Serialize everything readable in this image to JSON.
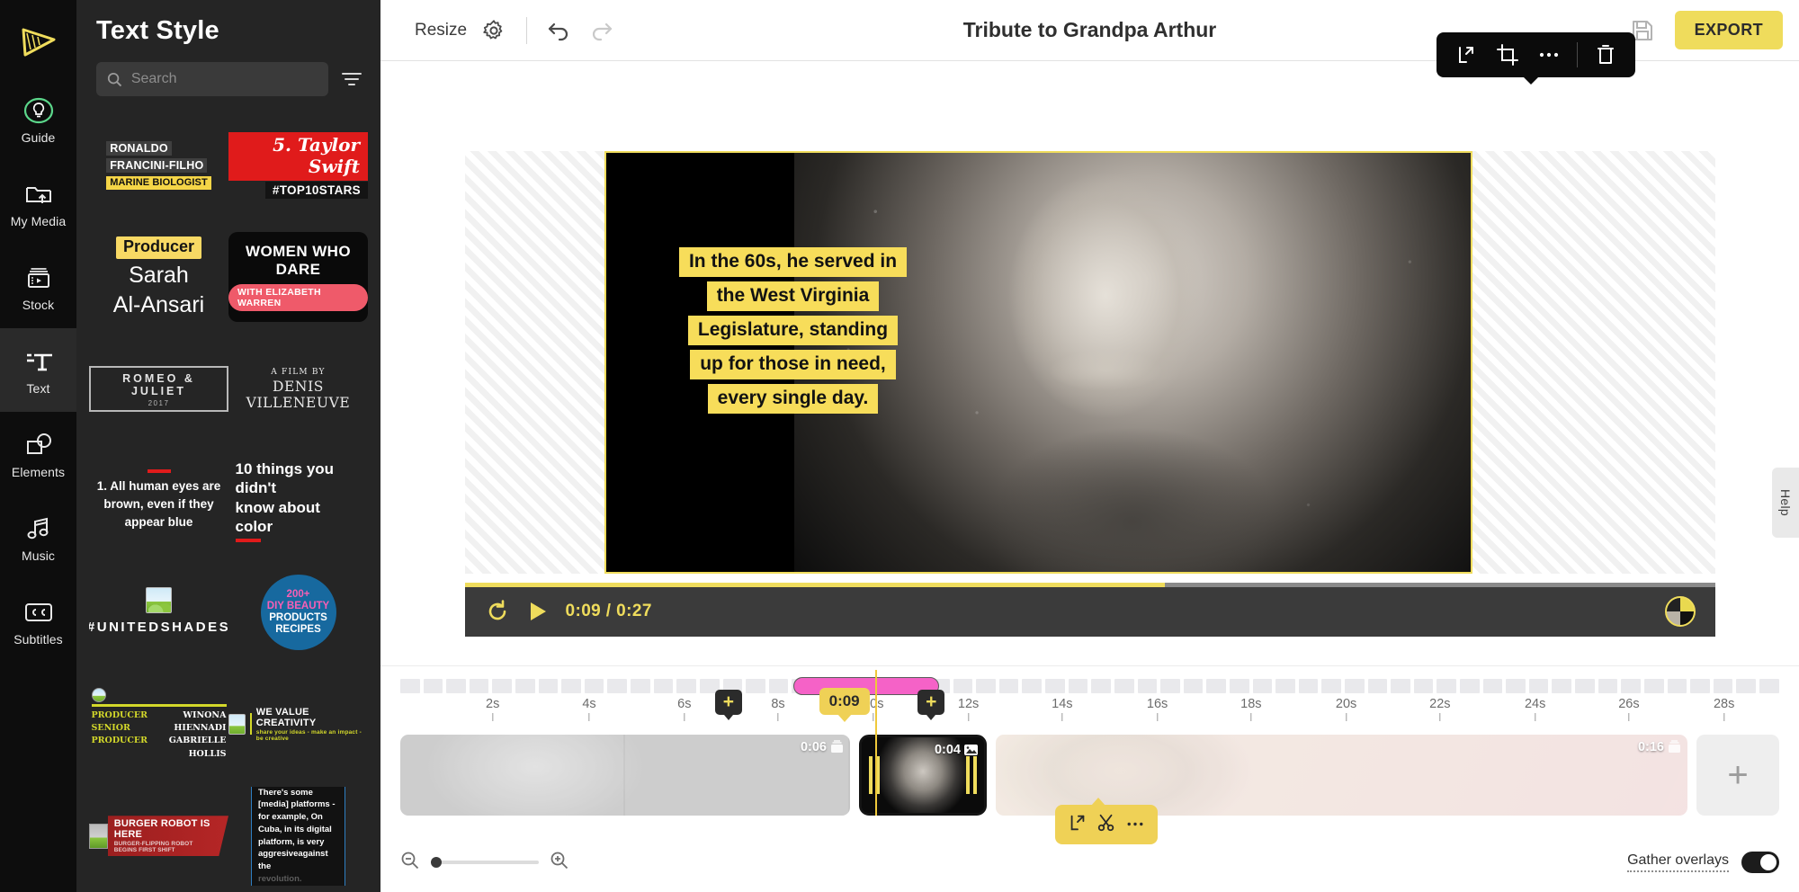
{
  "rail": {
    "logo_icon": "video-editor-logo-icon",
    "items": [
      {
        "label": "Guide",
        "icon": "lightbulb-icon",
        "active": false
      },
      {
        "label": "My Media",
        "icon": "folder-upload-icon",
        "active": false
      },
      {
        "label": "Stock",
        "icon": "stock-video-icon",
        "active": false
      },
      {
        "label": "Text",
        "icon": "text-tool-icon",
        "active": true
      },
      {
        "label": "Elements",
        "icon": "shapes-icon",
        "active": false
      },
      {
        "label": "Music",
        "icon": "music-note-icon",
        "active": false
      },
      {
        "label": "Subtitles",
        "icon": "closed-caption-icon",
        "active": false
      }
    ]
  },
  "panel": {
    "title": "Text Style",
    "search_placeholder": "Search",
    "search_value": "",
    "search_icon": "search-icon",
    "filter_icon": "filter-icon",
    "styles": [
      {
        "id": "ronaldo",
        "line1": "RONALDO",
        "line2": "FRANCINI-FILHO",
        "line3": "MARINE BIOLOGIST"
      },
      {
        "id": "taylor",
        "line1": "5. Taylor Swift",
        "line2": "#TOP10STARS"
      },
      {
        "id": "producer",
        "line1": "Producer",
        "line2": "Sarah",
        "line3": "Al-Ansari"
      },
      {
        "id": "women",
        "line1": "WOMEN WHO",
        "line2": "DARE",
        "line3": "WITH ELIZABETH WARREN"
      },
      {
        "id": "romeo",
        "line1": "ROMEO & JULIET",
        "line2": "2017"
      },
      {
        "id": "denis",
        "line1": "A FILM BY",
        "line2": "DENIS VILLENEUVE"
      },
      {
        "id": "eyes",
        "line1": "1.  All human eyes are brown, even if they appear blue"
      },
      {
        "id": "tenthings",
        "line1": "10 things you didn't",
        "line2": "know about color"
      },
      {
        "id": "united",
        "line1": "#UNITEDSHADES",
        "icon": "image-thumb-icon"
      },
      {
        "id": "beauty",
        "line1": "200+",
        "line2": "DIY BEAUTY",
        "line3": "PRODUCTS",
        "line4": "RECIPES"
      },
      {
        "id": "credits",
        "left1": "PRODUCER",
        "left2": "SENIOR",
        "left3": "PRODUCER",
        "right1": "WINONA HIENNADI",
        "right2": "GABRIELLE",
        "right3": "HOLLIS",
        "icon": "image-thumb-icon"
      },
      {
        "id": "value",
        "line1": "WE VALUE CREATIVITY",
        "line2": "share your ideas - make an impact - be creative",
        "icon": "image-thumb-icon"
      },
      {
        "id": "burger",
        "line1": "BURGER ROBOT IS HERE",
        "line2": "BURGER-FLIPPING ROBOT BEGINS FIRST SHIFT",
        "icon": "image-thumb-icon"
      },
      {
        "id": "media",
        "line1": "There's some [media] platforms - for example, On Cuba, in its digital platform, is very aggresiveagainst the",
        "line2": "revolution."
      }
    ]
  },
  "topbar": {
    "resize_label": "Resize",
    "settings_icon": "gear-icon",
    "undo_icon": "undo-icon",
    "redo_icon": "redo-icon",
    "project_title": "Tribute to Grandpa Arthur",
    "save_icon": "save-icon",
    "export_label": "EXPORT"
  },
  "float_toolbar": {
    "buttons": [
      {
        "icon": "replace-icon",
        "name": "replace-button"
      },
      {
        "icon": "crop-icon",
        "name": "crop-button"
      },
      {
        "icon": "more-icon",
        "name": "more-options-button"
      },
      {
        "icon": "trash-icon",
        "name": "delete-button"
      }
    ]
  },
  "preview": {
    "caption_lines": [
      "In the 60s, he served in",
      "the West Virginia",
      "Legislature, standing",
      "up for those in need,",
      "every single day."
    ],
    "caption_bg": "#f7dd5a",
    "caption_color": "#121212",
    "selection_color": "#efdc5c"
  },
  "playbar": {
    "loop_icon": "loop-icon",
    "play_icon": "play-icon",
    "current_time": "0:09",
    "total_time": "0:27",
    "time_display": "0:09 / 0:27",
    "progress_percent": 56,
    "avatar_icon": "avatar-icon",
    "accent": "#efdc5c"
  },
  "help": {
    "label": "Help"
  },
  "timeline": {
    "tick_labels": [
      "2s",
      "4s",
      "6s",
      "8s",
      "10s",
      "12s",
      "14s",
      "16s",
      "18s",
      "20s",
      "22s",
      "24s",
      "26s",
      "28s"
    ],
    "playhead_time": "0:09",
    "add_button_label": "+",
    "pink_range_color": "#f562c7",
    "clips": [
      {
        "name": "clip-1",
        "duration": "0:06",
        "type_icon": "stack-icon",
        "selected": false
      },
      {
        "name": "clip-2-selected",
        "duration": "0:04",
        "type_icon": "image-icon",
        "selected": true
      },
      {
        "name": "clip-3",
        "duration": "0:16",
        "type_icon": "stack-icon",
        "selected": false
      }
    ],
    "add_media_label": "+",
    "clip_toolbar": [
      {
        "icon": "replace-icon",
        "name": "replace-clip-button"
      },
      {
        "icon": "scissors-icon",
        "name": "split-clip-button"
      },
      {
        "icon": "more-icon",
        "name": "clip-more-button"
      }
    ],
    "zoom_out_icon": "zoom-out-icon",
    "zoom_in_icon": "zoom-in-icon",
    "zoom_value": 5,
    "gather_overlays_label": "Gather overlays",
    "gather_overlays_on": true
  }
}
